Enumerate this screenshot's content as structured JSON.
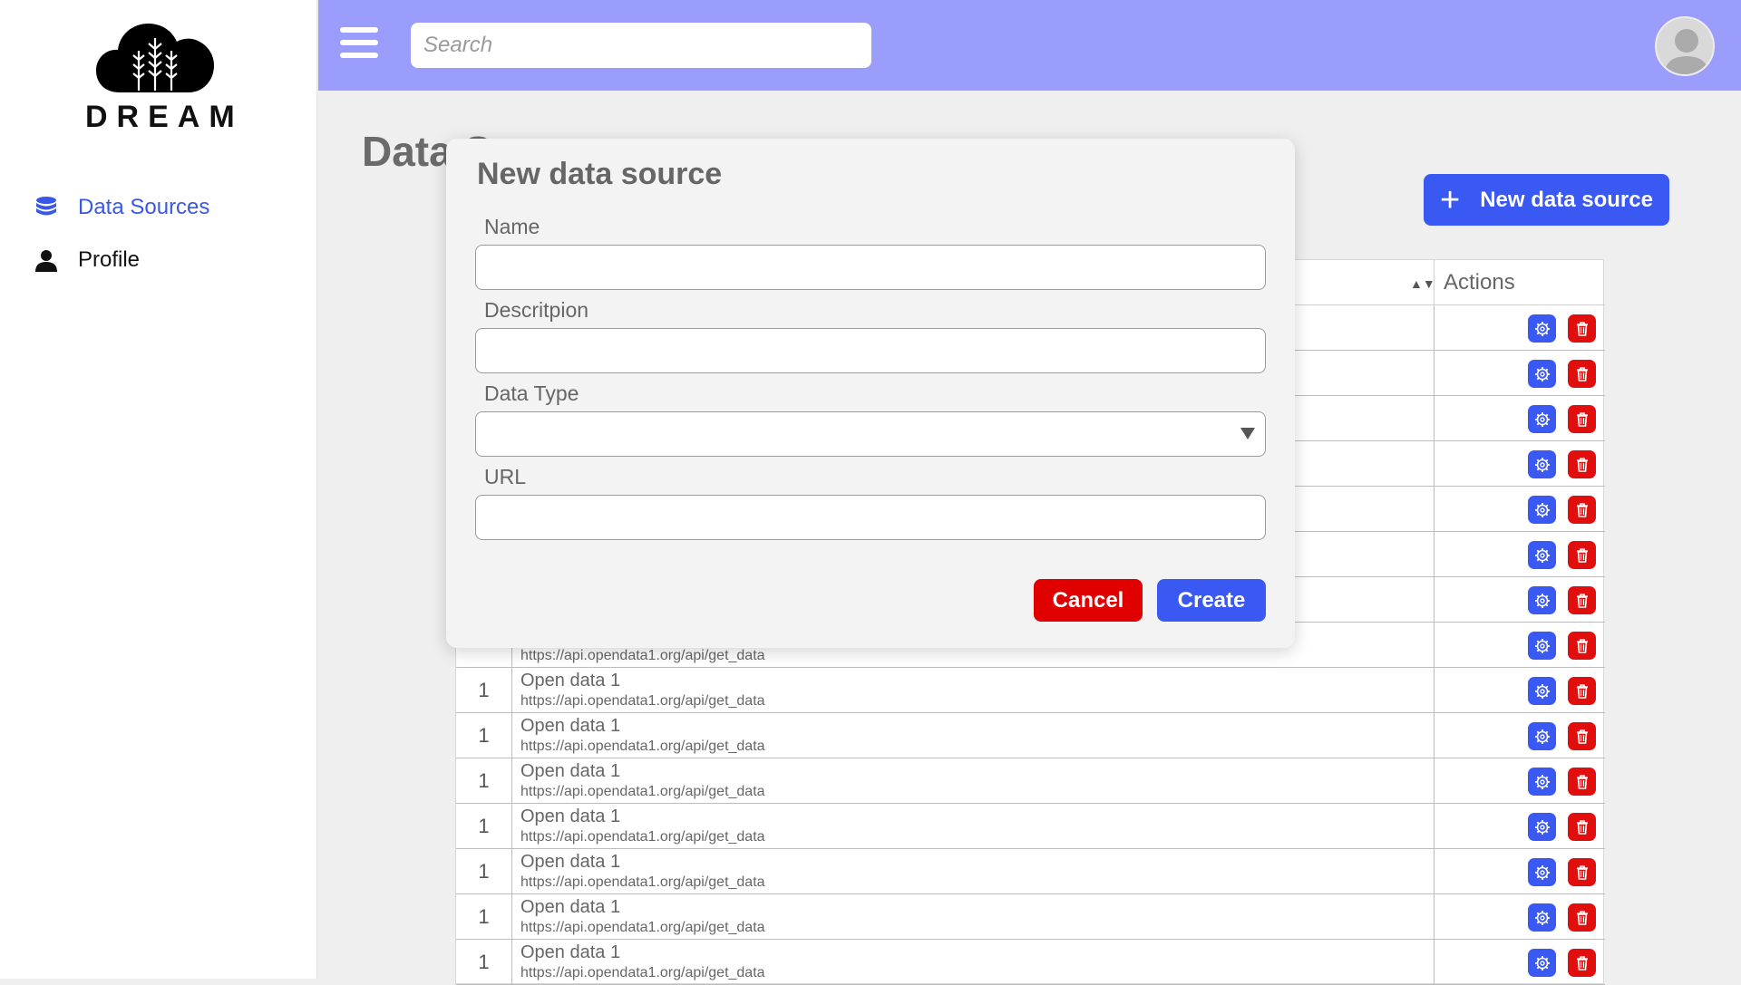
{
  "app": {
    "logo_text": "DREAM"
  },
  "sidebar": {
    "items": [
      {
        "label": "Data Sources",
        "icon": "database-icon",
        "active": true
      },
      {
        "label": "Profile",
        "icon": "user-icon",
        "active": false
      }
    ]
  },
  "header": {
    "search_placeholder": "Search",
    "menu_icon": "hamburger-icon",
    "avatar_icon": "user-avatar-icon"
  },
  "main": {
    "page_title": "Data S",
    "new_button_label": "New data source",
    "table": {
      "columns": [
        "Actions"
      ],
      "rows_partial": [
        {
          "id": "1",
          "url": "https://api.opendata1.org/api/get_data"
        }
      ],
      "rows": [
        {
          "id": "1",
          "name": "Open data 1",
          "url": "https://api.opendata1.org/api/get_data"
        },
        {
          "id": "1",
          "name": "Open data 1",
          "url": "https://api.opendata1.org/api/get_data"
        },
        {
          "id": "1",
          "name": "Open data 1",
          "url": "https://api.opendata1.org/api/get_data"
        },
        {
          "id": "1",
          "name": "Open data 1",
          "url": "https://api.opendata1.org/api/get_data"
        },
        {
          "id": "1",
          "name": "Open data 1",
          "url": "https://api.opendata1.org/api/get_data"
        },
        {
          "id": "1",
          "name": "Open data 1",
          "url": "https://api.opendata1.org/api/get_data"
        },
        {
          "id": "1",
          "name": "Open data 1",
          "url": "https://api.opendata1.org/api/get_data"
        }
      ]
    }
  },
  "modal": {
    "title": "New data source",
    "fields": [
      {
        "label": "Name",
        "value": ""
      },
      {
        "label": "Descritpion",
        "value": ""
      },
      {
        "label": "Data Type",
        "value": ""
      },
      {
        "label": "URL",
        "value": ""
      }
    ],
    "cancel_label": "Cancel",
    "create_label": "Create"
  },
  "colors": {
    "accent": "#3a58f2",
    "danger": "#e10e0e",
    "header_bg": "#9a9dfc",
    "active_nav": "#3a58e6"
  }
}
